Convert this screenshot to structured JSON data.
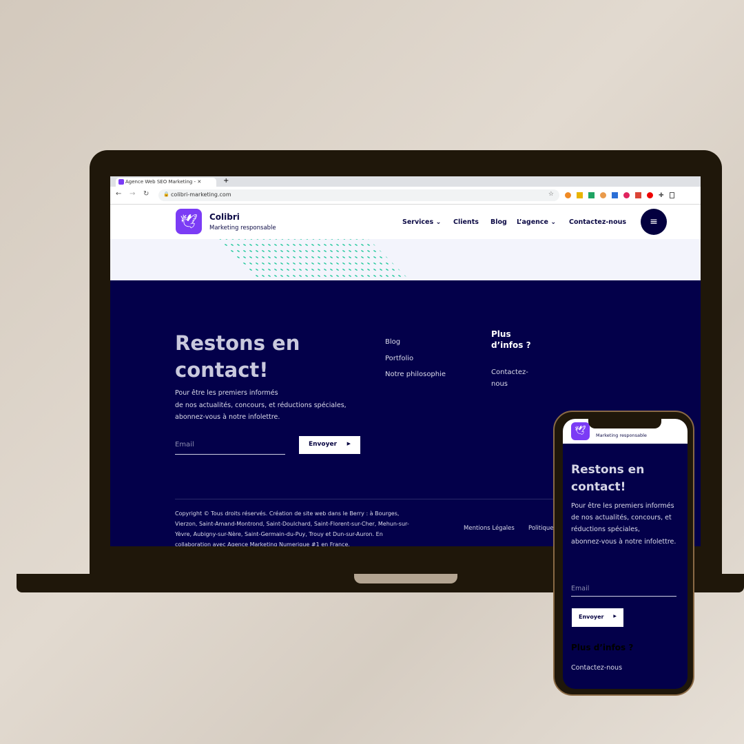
{
  "browser": {
    "tab_title": "Agence Web SEO Marketing - ",
    "new_tab": "+",
    "url": "colibri-marketing.com"
  },
  "site": {
    "brand": "Colibri",
    "tagline": "Marketing responsable",
    "menu": [
      "Services",
      "Clients",
      "Blog",
      "L’agence",
      "Contactez-nous"
    ]
  },
  "footer": {
    "heading": "Restons en contact!",
    "text_line1": "Pour être les premiers informés",
    "text_line2": "de nos actualités, concours, et réductions spéciales,",
    "text_line3": "abonnez-vous à notre infolettre.",
    "email_placeholder": "Email",
    "submit": "Envoyer",
    "links": [
      "Blog",
      "Portfolio",
      "Notre philosophie"
    ],
    "more_heading": "Plus d’infos ?",
    "more_link": "Contactez-nous",
    "copyright": "Copyright © Tous droits réservés. Création de site web dans le Berry : à Bourges, Vierzon, Saint-Amand-Montrond, Saint-Doulchard, Saint-Florent-sur-Cher, Mehun-sur-Yèvre, Aubigny-sur-Nère, Saint-Germain-du-Puy, Trouy  et Dun-sur-Auron. En collaboration avec Agence Marketing Numerique #1 en France.",
    "legal": "Mentions Légales",
    "policy": "Politique"
  },
  "colors": {
    "navy": "#03004a",
    "brand": "#7b3cf5",
    "dots": "#1cc79a"
  }
}
